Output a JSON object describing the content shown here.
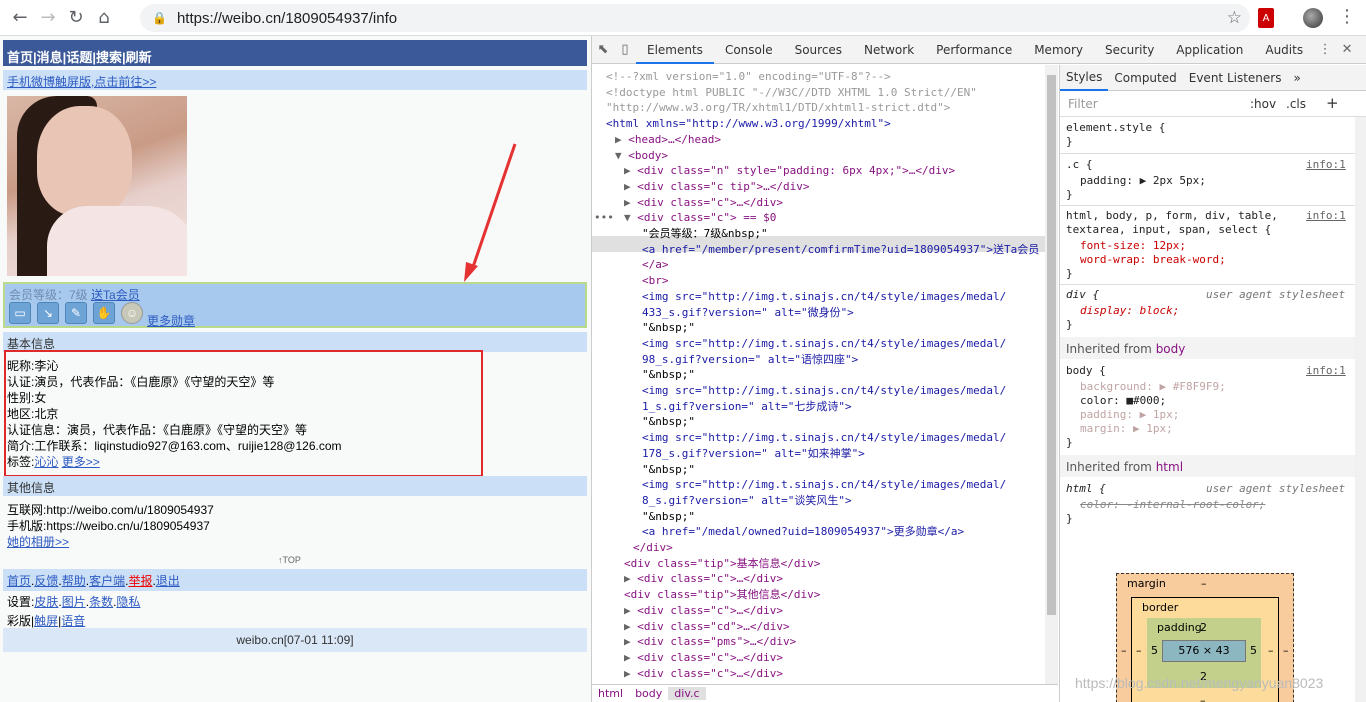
{
  "browser": {
    "url": "https://weibo.cn/1809054937/info",
    "pdf_label": "A"
  },
  "page": {
    "topbar": [
      "首页",
      "消息",
      "话题",
      "搜索",
      "刷新"
    ],
    "touch_link": "手机微博触屏版,点击前往>>",
    "medal": {
      "level_label": "会员等级：7级",
      "gift_link": "送Ta会员",
      "more_link": "更多勋章",
      "icons": [
        "微身份",
        "语惊四座",
        "七步成诗",
        "如来神掌",
        "谈笑风生"
      ]
    },
    "basic_header": "基本信息",
    "basic": {
      "nickname": "昵称:李沁",
      "verify": "认证:演员，代表作品：《白鹿原》《守望的天空》等",
      "gender": "性别:女",
      "region": "地区:北京",
      "verify_info": "认证信息：演员，代表作品：《白鹿原》《守望的天空》等",
      "intro": "简介:工作联系：liqinstudio927@163.com、ruijie128@126.com",
      "tags_prefix": "标签:",
      "tag1": "沁沁",
      "tags_more": "更多>>"
    },
    "other_header": "其他信息",
    "other": {
      "internet": "互联网:http://weibo.com/u/1809054937",
      "mobile": "手机版:https://weibo.cn/u/1809054937",
      "album": "她的相册>>"
    },
    "top_label": "TOP",
    "nav_links": [
      "首页",
      "反馈",
      "帮助",
      "客户端",
      "举报",
      "退出"
    ],
    "settings_prefix": "设置:",
    "settings_links": [
      "皮肤",
      "图片",
      "条数",
      "隐私"
    ],
    "version_prefix": "彩版",
    "version_links": [
      "触屏",
      "语音"
    ],
    "footer": "weibo.cn[07-01 11:09]"
  },
  "devtools": {
    "tabs": [
      "Elements",
      "Console",
      "Sources",
      "Network",
      "Performance",
      "Memory",
      "Security",
      "Application",
      "Audits"
    ],
    "active_tab": "Elements",
    "elements": [
      "<!--?xml version=\"1.0\" encoding=\"UTF-8\"?-->",
      "<!doctype html PUBLIC \"-//W3C//DTD XHTML 1.0 Strict//EN\"",
      "\"http://www.w3.org/TR/xhtml1/DTD/xhtml1-strict.dtd\">",
      "<html xmlns=\"http://www.w3.org/1999/xhtml\">",
      "<head>…</head>",
      "<body>",
      "<div class=\"n\" style=\"padding: 6px 4px;\">…</div>",
      "<div class=\"c tip\">…</div>",
      "<div class=\"c\">…</div>",
      "<div class=\"c\"> == $0",
      "\"会员等级：7级&nbsp;\"",
      "<a href=\"/member/present/comfirmTime?uid=1809054937\">送Ta会员",
      "</a>",
      "<br>",
      "<img src=\"http://img.t.sinajs.cn/t4/style/images/medal/",
      "433_s.gif?version=\" alt=\"微身份\">",
      "\"&nbsp;\"",
      "<img src=\"http://img.t.sinajs.cn/t4/style/images/medal/",
      "98_s.gif?version=\" alt=\"语惊四座\">",
      "\"&nbsp;\"",
      "<img src=\"http://img.t.sinajs.cn/t4/style/images/medal/",
      "1_s.gif?version=\" alt=\"七步成诗\">",
      "\"&nbsp;\"",
      "<img src=\"http://img.t.sinajs.cn/t4/style/images/medal/",
      "178_s.gif?version=\" alt=\"如来神掌\">",
      "\"&nbsp;\"",
      "<img src=\"http://img.t.sinajs.cn/t4/style/images/medal/",
      "8_s.gif?version=\" alt=\"谈笑风生\">",
      "\"&nbsp;\"",
      "<a href=\"/medal/owned?uid=1809054937\">更多勋章</a>",
      "</div>",
      "<div class=\"tip\">基本信息</div>",
      "<div class=\"c\">…</div>",
      "<div class=\"tip\">其他信息</div>",
      "<div class=\"c\">…</div>",
      "<div class=\"cd\">…</div>",
      "<div class=\"pms\">…</div>",
      "<div class=\"c\">…</div>",
      "<div class=\"c\">…</div>"
    ],
    "breadcrumbs": [
      "html",
      "body",
      "div.c"
    ],
    "styles_tabs": [
      "Styles",
      "Computed",
      "Event Listeners",
      "»"
    ],
    "filter_placeholder": "Filter",
    "hov": ":hov",
    "cls": ".cls",
    "rules": {
      "element_style": "element.style {",
      "c_selector": ".c {",
      "c_link": "info:1",
      "c_padding": "padding: ▶ 2px 5px;",
      "html_sel1": "html, body, p, form, div, table,",
      "html_sel2": "textarea, input, span, select {",
      "html_link": "info:1",
      "html_fs": "font-size: 12px;",
      "html_ww": "word-wrap: break-word;",
      "div_sel": "div {",
      "ua": "user agent stylesheet",
      "div_display": "display: block;",
      "inherited_body_label": "Inherited from",
      "inherited_body_tag": "body",
      "body_sel": "body {",
      "body_link": "info:1",
      "body_bg": "background: ▶ #F8F9F9;",
      "body_color": "color: ■#000;",
      "body_padding": "padding: ▶ 1px;",
      "body_margin": "margin: ▶ 1px;",
      "inherited_html_label": "Inherited from",
      "inherited_html_tag": "html",
      "html_rule_sel": "html {",
      "html_rule_color": "color: -internal-root-color;",
      "close": "}"
    },
    "box_model": {
      "margin": "margin",
      "margin_val": "–",
      "border": "border",
      "border_val": "–",
      "padding": "padding",
      "pad_top": "2",
      "pad_bottom": "2",
      "pad_left": "5",
      "pad_right": "5",
      "content": "576 × 43",
      "side_dash": "–"
    }
  },
  "watermark": "https://blog.csdn.net/mengyanyuan8023"
}
